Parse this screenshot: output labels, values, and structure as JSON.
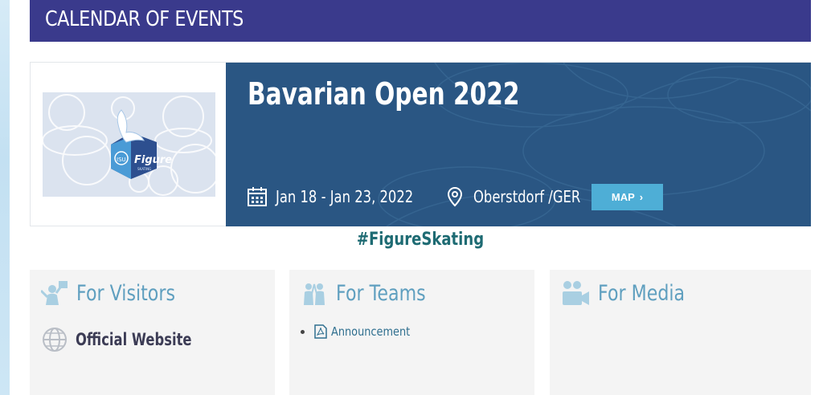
{
  "header": {
    "title": "CALENDAR OF EVENTS"
  },
  "event": {
    "logo_text": "Figure",
    "logo_subtext": "SKATING",
    "title": "Bavarian Open 2022",
    "dates": "Jan 18 - Jan 23, 2022",
    "location": "Oberstdorf /GER",
    "map_label": "MAP"
  },
  "hashtag": "#FigureSkating",
  "boxes": {
    "visitors": {
      "title": "For Visitors",
      "link_label": "Official Website"
    },
    "teams": {
      "title": "For Teams",
      "items": [
        {
          "label": "Announcement"
        }
      ]
    },
    "media": {
      "title": "For Media"
    }
  },
  "colors": {
    "header_bg": "#3a3a8c",
    "banner_bg": "#2a5683",
    "map_button": "#4eaed6",
    "hashtag": "#1e6b73",
    "box_title": "#5f9fbf"
  },
  "icons": {
    "calendar": "calendar-icon",
    "location": "location-pin-icon",
    "map_chevron": "chevron-right-icon",
    "visitors": "visitors-icon",
    "teams": "teams-icon",
    "media": "media-icon",
    "website": "globe-icon",
    "document": "pdf-icon"
  }
}
